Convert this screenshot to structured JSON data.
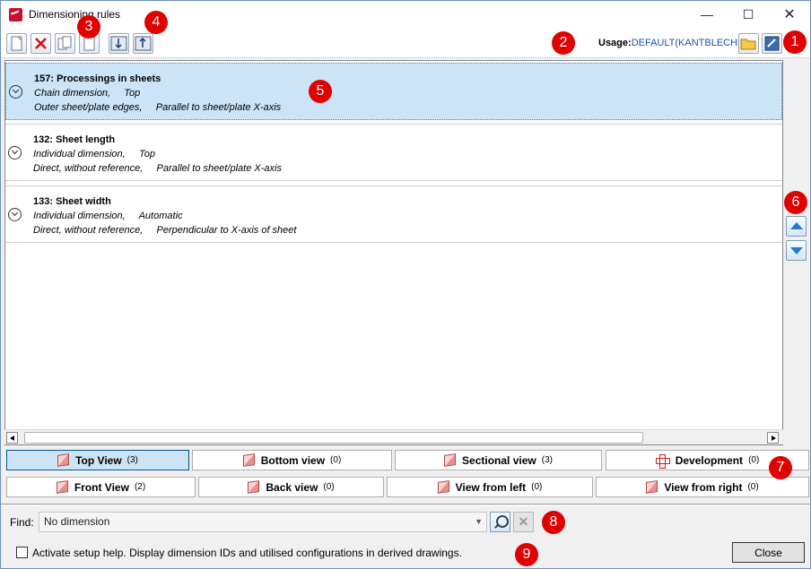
{
  "window": {
    "title": "Dimensioning rules",
    "minimize": "—",
    "maximize": "☐",
    "close": "✕"
  },
  "toolbar": {
    "usage_label": "Usage:",
    "usage_value": "DEFAULT(KANTBLECHE)"
  },
  "rules": [
    {
      "title": "157: Processings in sheets",
      "line1": "Chain dimension,     Top",
      "line2": "Outer sheet/plate edges,     Parallel to sheet/plate X-axis",
      "selected": true
    },
    {
      "title": "132: Sheet length",
      "line1": "Individual dimension,     Top",
      "line2": "Direct, without reference,     Parallel to sheet/plate X-axis",
      "selected": false
    },
    {
      "title": "133: Sheet width",
      "line1": "Individual dimension,     Automatic",
      "line2": "Direct, without reference,     Perpendicular to X-axis of sheet",
      "selected": false
    }
  ],
  "views_row1": [
    {
      "label": "Top View",
      "count": "(3)",
      "icon": "cube-icon",
      "active": true
    },
    {
      "label": "Bottom view",
      "count": "(0)",
      "icon": "cube-icon",
      "active": false
    },
    {
      "label": "Sectional view",
      "count": "(3)",
      "icon": "cube-icon",
      "active": false
    },
    {
      "label": "Development",
      "count": "(0)",
      "icon": "development-icon",
      "active": false
    }
  ],
  "views_row2": [
    {
      "label": "Front View",
      "count": "(2)",
      "icon": "cube-icon"
    },
    {
      "label": "Back view",
      "count": "(0)",
      "icon": "cube-icon"
    },
    {
      "label": "View from left",
      "count": "(0)",
      "icon": "cube-icon"
    },
    {
      "label": "View from right",
      "count": "(0)",
      "icon": "cube-icon"
    }
  ],
  "find": {
    "label": "Find:",
    "value": "No dimension"
  },
  "setup_help": {
    "label": "Activate setup help. Display dimension IDs and utilised configurations in derived drawings.",
    "checked": false
  },
  "close_label": "Close",
  "callouts": [
    "1",
    "2",
    "3",
    "4",
    "5",
    "6",
    "7",
    "8",
    "9"
  ],
  "colors": {
    "selection": "#cce4f7",
    "callout": "#e00000",
    "usage_value": "#1f4fa8"
  }
}
